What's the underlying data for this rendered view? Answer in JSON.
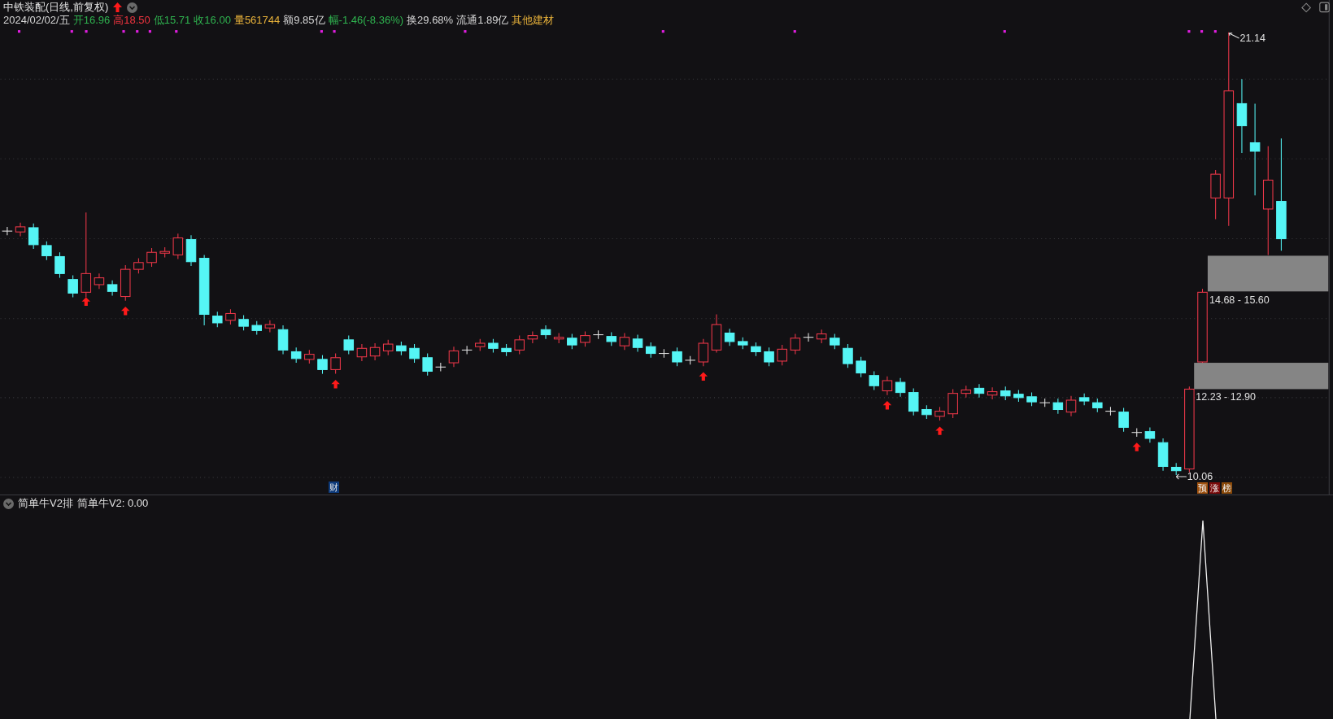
{
  "title": "中铁装配(日线,前复权)",
  "quote": [
    {
      "text": "2024/02/02/五",
      "color": "#d6d6d6"
    },
    {
      "text": "开16.96",
      "color": "#2fb34f"
    },
    {
      "text": "高18.50",
      "color": "#f0343f"
    },
    {
      "text": "低15.71",
      "color": "#2fb34f"
    },
    {
      "text": "收16.00",
      "color": "#2fb34f"
    },
    {
      "text": "量561744",
      "color": "#e8b23a"
    },
    {
      "text": "额9.85亿",
      "color": "#d6d6d6"
    },
    {
      "text": "幅-1.46(-8.36%)",
      "color": "#2fb34f"
    },
    {
      "text": "换29.68%",
      "color": "#d6d6d6"
    },
    {
      "text": "流通1.89亿",
      "color": "#d6d6d6"
    },
    {
      "text": "其他建材",
      "color": "#e8b23a"
    }
  ],
  "chart": {
    "high_label": "21.14",
    "low_label": "10.06",
    "zones": [
      {
        "label": "14.68 - 15.60"
      },
      {
        "label": "12.23 - 12.90"
      }
    ],
    "event_badge": "财",
    "tags": [
      {
        "text": "预",
        "color": "#a0520f"
      },
      {
        "text": "涨",
        "color": "#7a0a0a"
      },
      {
        "text": "榜",
        "color": "#8a4a0a"
      }
    ]
  },
  "indicator": {
    "name": "简单牛V2排",
    "value": "简单牛V2: 0.00"
  }
}
